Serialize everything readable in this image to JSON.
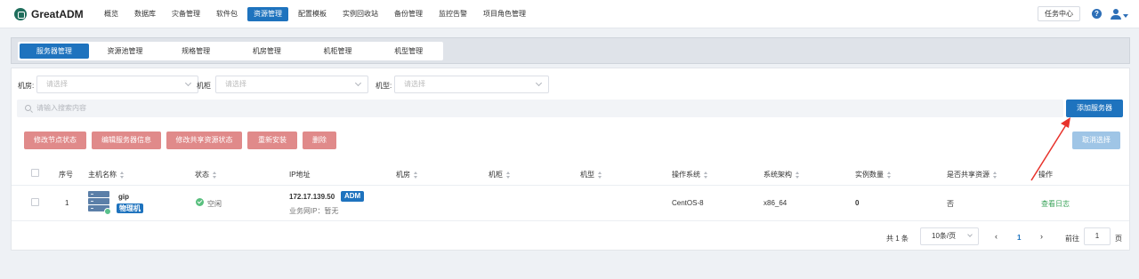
{
  "app": {
    "name": "GreatADM"
  },
  "nav": {
    "items": [
      "概览",
      "数据库",
      "灾备管理",
      "软件包",
      "资源管理",
      "配置模板",
      "实例回收站",
      "备份管理",
      "监控告警",
      "项目角色管理"
    ],
    "active_index": 4
  },
  "top_right": {
    "task_center": "任务中心",
    "help_icon": "help-icon",
    "user_icon": "user-icon"
  },
  "subtabs": {
    "items": [
      "服务器管理",
      "资源池管理",
      "规格管理",
      "机房管理",
      "机柜管理",
      "机型管理"
    ],
    "active_index": 0
  },
  "filters": {
    "room": {
      "label": "机房:",
      "placeholder": "请选择"
    },
    "rack": {
      "label": "机柜",
      "placeholder": "请选择"
    },
    "model": {
      "label": "机型:",
      "placeholder": "请选择"
    }
  },
  "search": {
    "placeholder": "请输入搜索内容"
  },
  "actions": {
    "modify_node_status": "修改节点状态",
    "edit_server_info": "编辑服务器信息",
    "modify_shared_status": "修改共享资源状态",
    "reinstall": "重新安装",
    "delete": "删除",
    "add_server": "添加服务器",
    "cancel_selection": "取消选择"
  },
  "table": {
    "headers": [
      "序号",
      "主机名称",
      "状态",
      "IP地址",
      "机房",
      "机柜",
      "机型",
      "操作系统",
      "系统架构",
      "实例数量",
      "是否共享资源",
      "操作"
    ],
    "rows": [
      {
        "index": "1",
        "hostname": "gip",
        "host_tag": "物理机",
        "status": "空闲",
        "ip": "172.17.139.50",
        "ip_tag": "ADM",
        "business_ip": "业务网IP：暂无",
        "room": "",
        "rack": "",
        "model": "",
        "os": "CentOS-8",
        "arch": "x86_64",
        "instances": "0",
        "shared": "否",
        "action": "查看日志"
      }
    ]
  },
  "pagination": {
    "total": "共 1 条",
    "page_size": "10条/页",
    "current_page": "1",
    "goto_label": "前往",
    "goto_value": "1",
    "page_suffix": "页"
  },
  "colors": {
    "primary": "#1e73be",
    "danger_light": "#e08a8a",
    "success": "#59bf7e",
    "link_green": "#3aa35a",
    "annotation_red": "#e8322b"
  }
}
